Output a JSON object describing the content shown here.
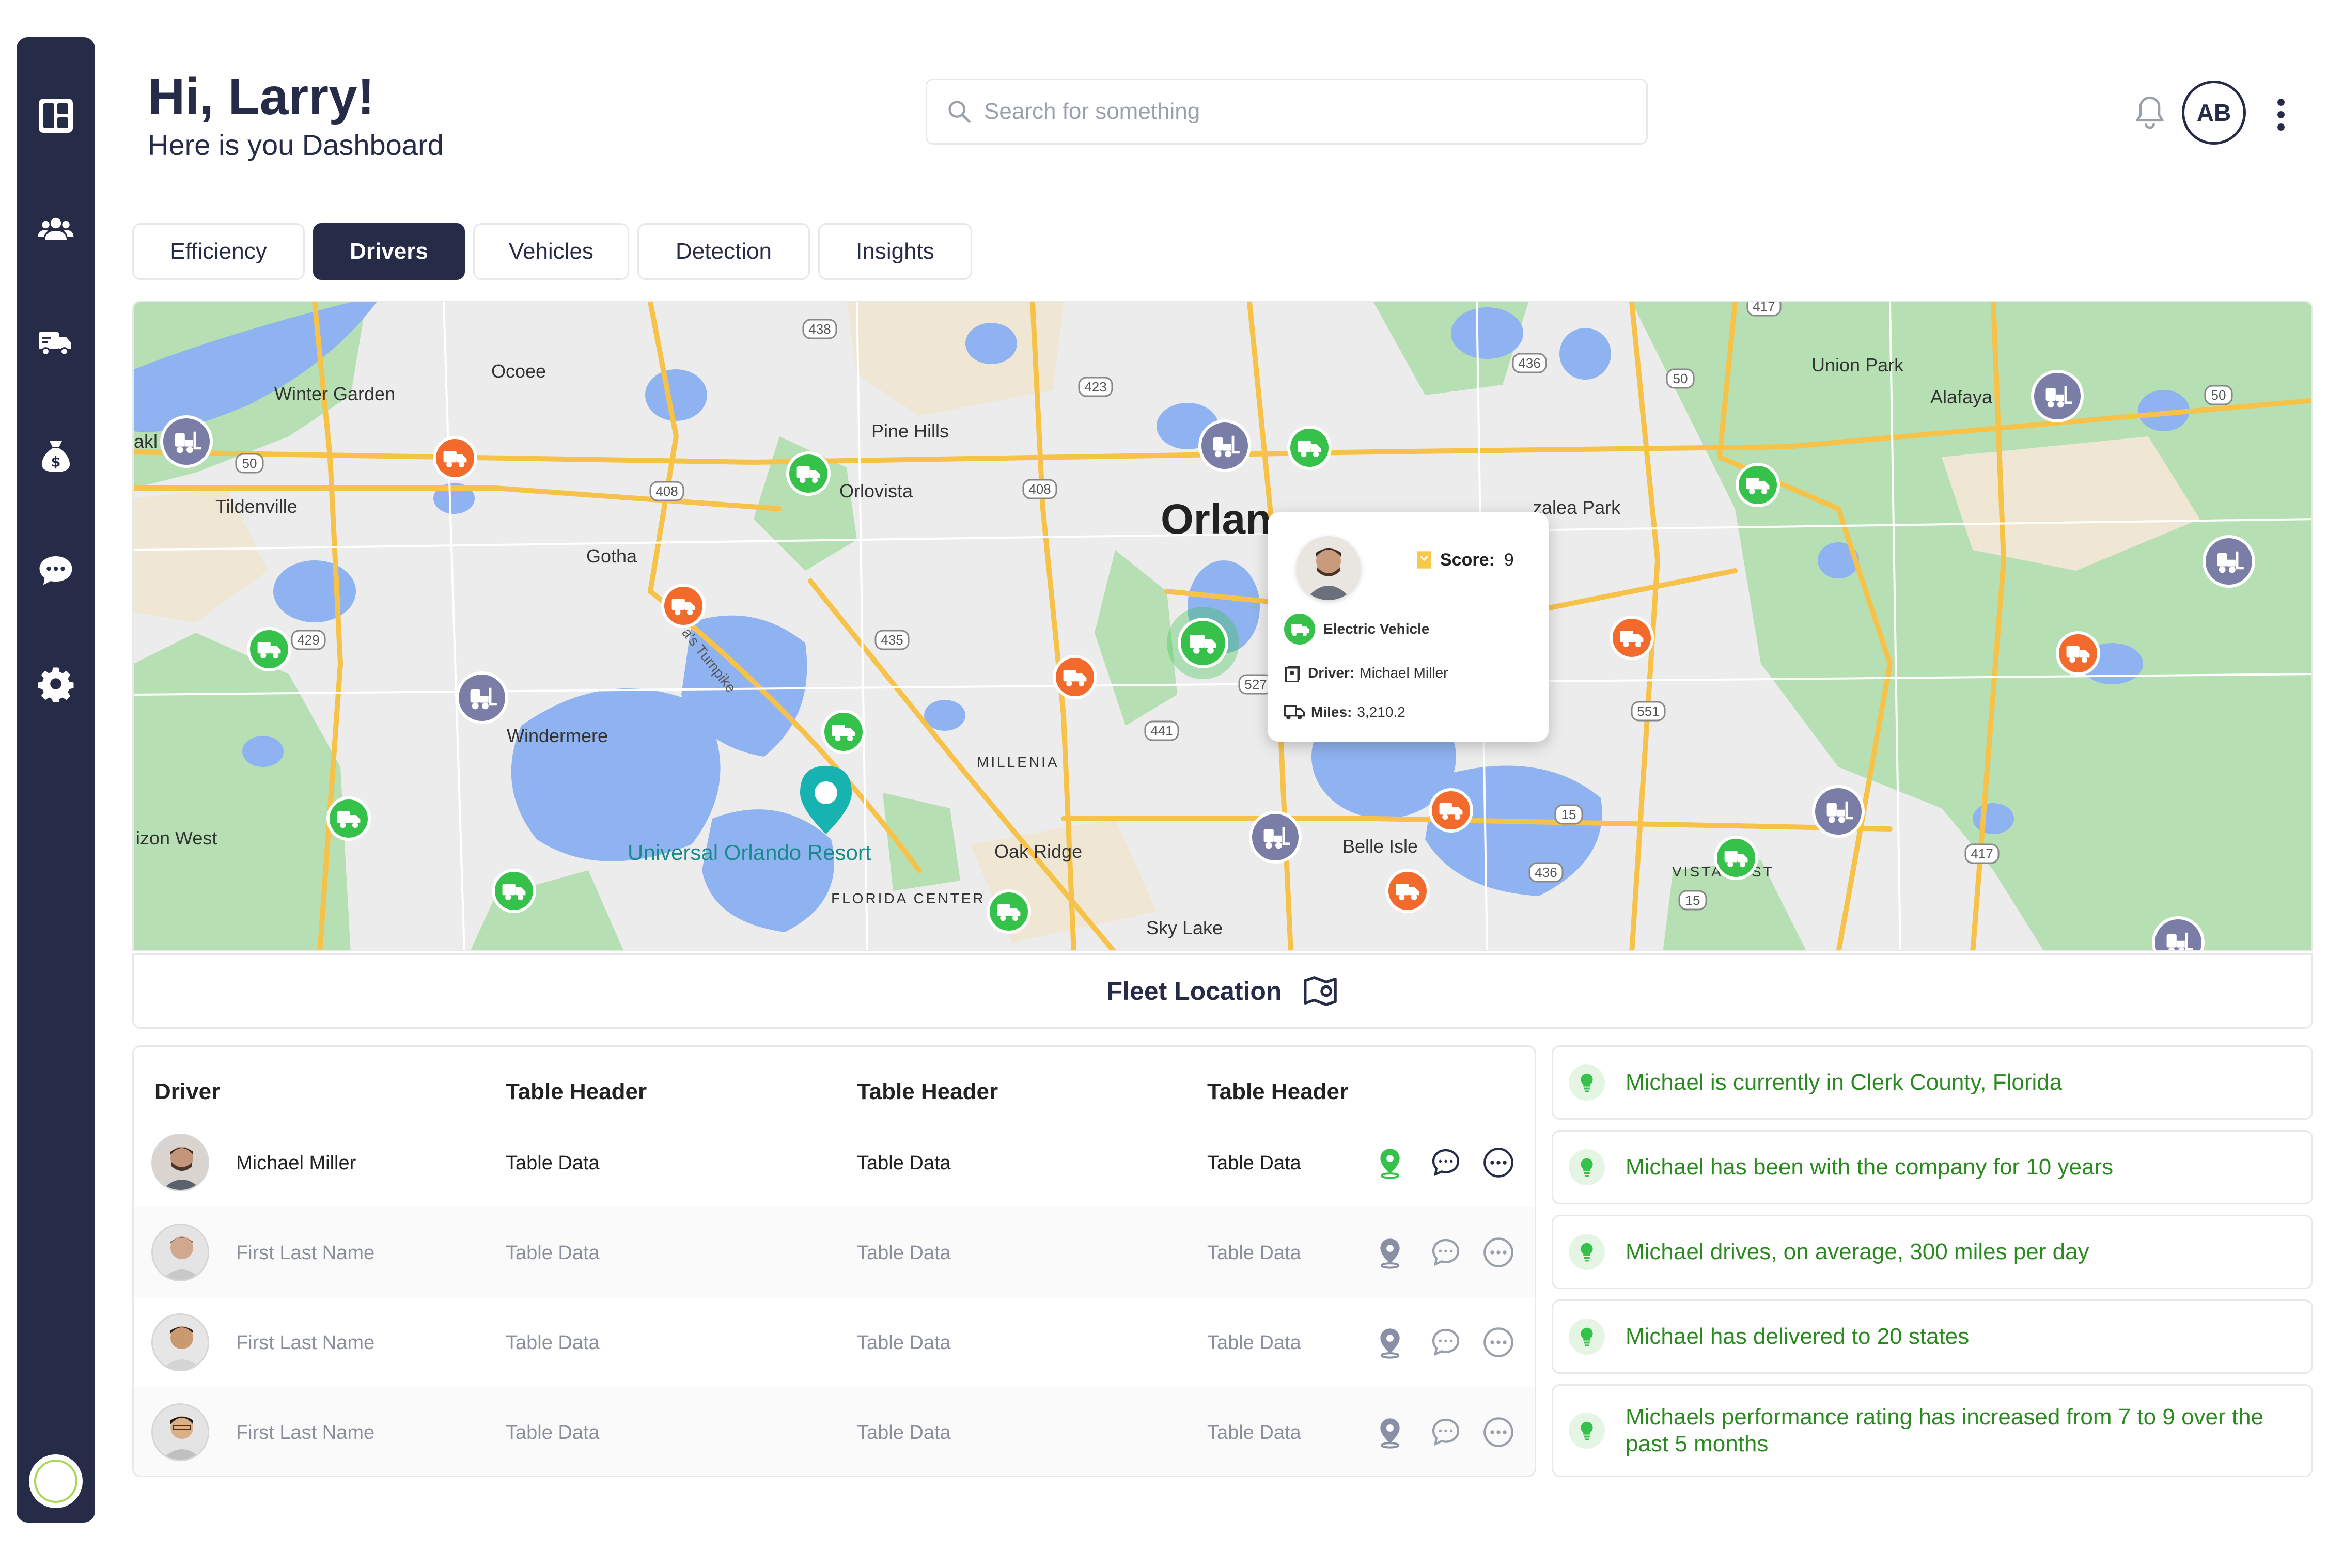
{
  "header": {
    "greeting": "Hi, Larry!",
    "subtitle": "Here is you Dashboard",
    "search_placeholder": "Search for something",
    "avatar_initials": "AB"
  },
  "tabs": [
    {
      "label": "Efficiency",
      "active": false
    },
    {
      "label": "Drivers",
      "active": true
    },
    {
      "label": "Vehicles",
      "active": false
    },
    {
      "label": "Detection",
      "active": false
    },
    {
      "label": "Insights",
      "active": false
    }
  ],
  "map": {
    "place_labels": [
      "Winter Garden",
      "Ocoee",
      "Pine Hills",
      "Orlovista",
      "Tildenville",
      "Gotha",
      "Windermere",
      "izon West",
      "Universal Orlando Resort",
      "Oak Ridge",
      "MILLENIA",
      "FLORIDA CENTER",
      "Sky Lake",
      "Belle Isle",
      "Orlan",
      "Union Park",
      "Alafaya",
      "zalea Park",
      "VISTA",
      "ST",
      "akl"
    ],
    "route_labels": [
      "438",
      "423",
      "408",
      "408",
      "50",
      "50",
      "50",
      "436",
      "429",
      "435",
      "441",
      "527",
      "551",
      "15",
      "15",
      "436",
      "417",
      "417",
      "a's Turnpike"
    ],
    "popup": {
      "score_label": "Score:",
      "score_value": "9",
      "vehicle_type": "Electric Vehicle",
      "driver_label": "Driver:",
      "driver_value": "Michael Miller",
      "miles_label": "Miles:",
      "miles_value": "3,210.2"
    },
    "fleet_location_label": "Fleet Location"
  },
  "table": {
    "headers": [
      "Driver",
      "Table Header",
      "Table Header",
      "Table Header"
    ],
    "rows": [
      {
        "name": "Michael Miller",
        "c1": "Table Data",
        "c2": "Table Data",
        "c3": "Table Data",
        "active": true
      },
      {
        "name": "First Last Name",
        "c1": "Table Data",
        "c2": "Table Data",
        "c3": "Table Data",
        "active": false
      },
      {
        "name": "First Last Name",
        "c1": "Table Data",
        "c2": "Table Data",
        "c3": "Table Data",
        "active": false
      },
      {
        "name": "First Last Name",
        "c1": "Table Data",
        "c2": "Table Data",
        "c3": "Table Data",
        "active": false
      }
    ]
  },
  "insights": [
    "Michael is currently in Clerk County, Florida",
    "Michael has been with the company for 10 years",
    "Michael drives, on average, 300 miles per day",
    "Michael has delivered to 20 states",
    "Michaels performance rating has increased from 7 to 9 over the past 5 months"
  ],
  "colors": {
    "sidebar": "#262b47",
    "accent_green": "#36c24a",
    "accent_orange": "#f26b2c",
    "accent_purple": "#7a7ea6",
    "insight_text": "#2a8a20"
  },
  "icons": {
    "sidebar": [
      "dashboard-icon",
      "users-icon",
      "truck-icon",
      "money-bag-icon",
      "chat-icon",
      "gear-icon"
    ],
    "row_actions": [
      "location-pin-icon",
      "chat-bubble-icon",
      "more-options-icon"
    ]
  }
}
